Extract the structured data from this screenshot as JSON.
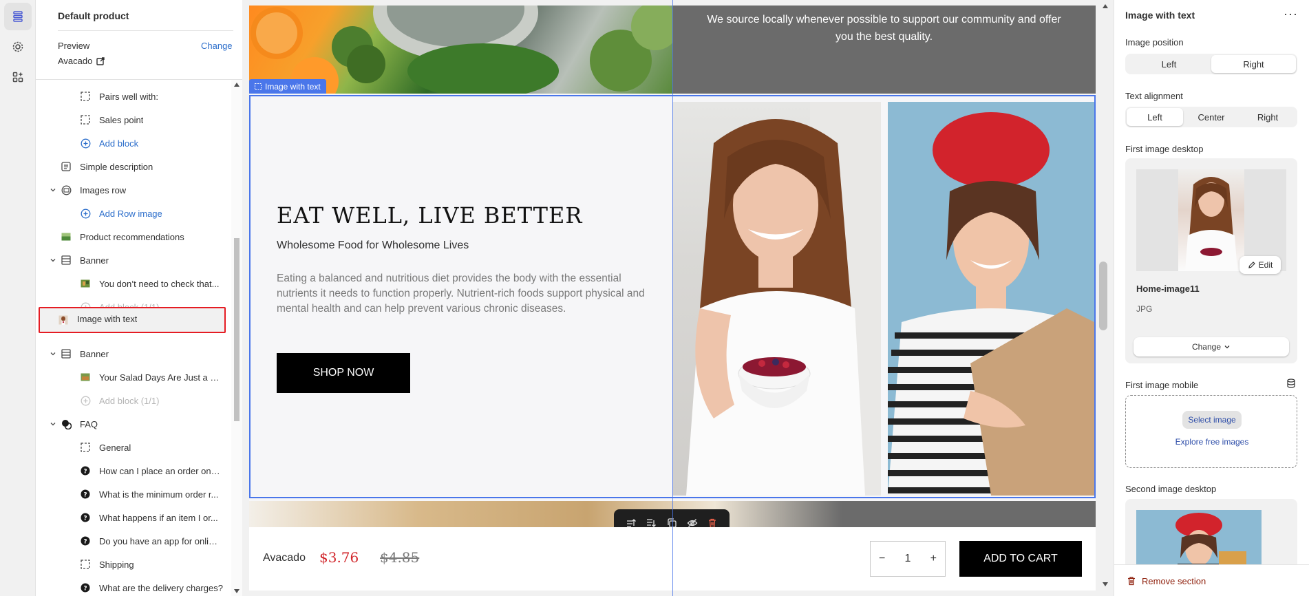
{
  "colors": {
    "accent": "#4a76ea",
    "link": "#2c6ecb",
    "price": "#d1252a",
    "selection": "#e51c23",
    "danger": "#8e1f0b"
  },
  "rail": {
    "icons": [
      "sections-icon",
      "settings-gear-icon",
      "apps-icon"
    ]
  },
  "tree": {
    "title": "Default product",
    "preview_label": "Preview",
    "change_label": "Change",
    "preview_value": "Avacado",
    "items": [
      {
        "label": "Pairs well with:",
        "icon": "block-icon"
      },
      {
        "label": "Sales point",
        "icon": "block-icon"
      },
      {
        "label": "Add block",
        "icon": "add-icon"
      },
      {
        "label": "Simple description",
        "icon": "text-icon"
      },
      {
        "label": "Images row",
        "icon": "images-icon"
      },
      {
        "label": "Add Row image",
        "icon": "add-icon"
      },
      {
        "label": "Product recommendations",
        "icon": "image-icon"
      },
      {
        "label": "Banner",
        "icon": "banner-icon"
      },
      {
        "label": "You don’t need to check that...",
        "icon": "image-icon"
      },
      {
        "label": "Add block (1/1)",
        "icon": "add-icon"
      },
      {
        "label": "Image with text",
        "icon": "image-icon"
      },
      {
        "label": "Banner",
        "icon": "banner-icon"
      },
      {
        "label": "Your Salad Days Are Just a Vi...",
        "icon": "image-icon"
      },
      {
        "label": "Add block (1/1)",
        "icon": "add-icon"
      },
      {
        "label": "FAQ",
        "icon": "faq-icon"
      },
      {
        "label": "General",
        "icon": "block-icon"
      },
      {
        "label": "How can I place an order on ...",
        "icon": "question-icon"
      },
      {
        "label": "What is the minimum order r...",
        "icon": "question-icon"
      },
      {
        "label": "What happens if an item I or...",
        "icon": "question-icon"
      },
      {
        "label": "Do you have an app for onlin...",
        "icon": "question-icon"
      },
      {
        "label": "Shipping",
        "icon": "block-icon"
      },
      {
        "label": "What are the delivery charges?",
        "icon": "question-icon"
      }
    ]
  },
  "canvas": {
    "top_text": "We source locally whenever possible to support our community and offer you the best quality.",
    "section_badge": "Image with text",
    "heading": "EAT WELL, LIVE BETTER",
    "subheading": "Wholesome Food for Wholesome Lives",
    "body": "Eating a balanced and nutritious diet provides the body with the essential nutrients it needs to function properly. Nutrient-rich foods support physical and mental health and can help prevent various chronic diseases.",
    "button": "SHOP NOW",
    "sticky": {
      "product": "Avacado",
      "price": "$3.76",
      "compare_price": "$4.85",
      "qty": "1",
      "qty_minus": "−",
      "qty_plus": "+",
      "add_to_cart": "ADD TO CART"
    }
  },
  "settings": {
    "title": "Image with text",
    "more": "···",
    "image_position_label": "Image position",
    "image_position_options": [
      "Left",
      "Right"
    ],
    "image_position_selected": "Right",
    "text_alignment_label": "Text alignment",
    "text_alignment_options": [
      "Left",
      "Center",
      "Right"
    ],
    "text_alignment_selected": "Left",
    "first_desktop_label": "First image desktop",
    "edit_label": "Edit",
    "image_name": "Home-image11",
    "image_type": "JPG",
    "change_label": "Change",
    "first_mobile_label": "First image mobile",
    "select_image": "Select image",
    "explore_free": "Explore free images",
    "second_desktop_label": "Second image desktop",
    "remove_section": "Remove section"
  }
}
